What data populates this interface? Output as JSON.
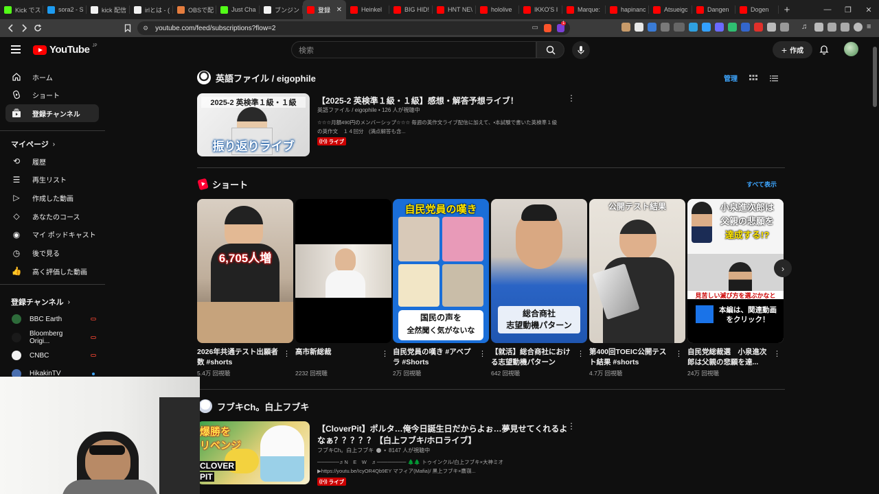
{
  "browser": {
    "tabs": [
      {
        "label": "Kick でス",
        "color": "#53fc18"
      },
      {
        "label": "sora2 - S",
        "color": "#1d9bf0"
      },
      {
        "label": "kick 配信",
        "color": "#f1f1f1"
      },
      {
        "label": "irlとは - (",
        "color": "#f1f1f1"
      },
      {
        "label": "OBSで配",
        "color": "#e57d3e"
      },
      {
        "label": "Just Cha",
        "color": "#53fc18"
      },
      {
        "label": "ブンジン",
        "color": "#f1f1f1"
      },
      {
        "label": "登録",
        "color": "#ff0000"
      },
      {
        "label": "Heinkel",
        "color": "#ff0000"
      },
      {
        "label": "BIG HID!",
        "color": "#ff0000"
      },
      {
        "label": "HNT NE\\",
        "color": "#ff0000"
      },
      {
        "label": "hololive",
        "color": "#ff0000"
      },
      {
        "label": "IKKO'S I",
        "color": "#ff0000"
      },
      {
        "label": "Marque:",
        "color": "#ff0000"
      },
      {
        "label": "hapinanc",
        "color": "#ff0000"
      },
      {
        "label": "Atsueigc",
        "color": "#ff0000"
      },
      {
        "label": "Dangen",
        "color": "#ff0000"
      },
      {
        "label": "Dogen",
        "color": "#ff0000"
      }
    ],
    "active_tab_index": 7,
    "url": "youtube.com/feed/subscriptions?flow=2",
    "shield_count": "1"
  },
  "masthead": {
    "logo_text": "YouTube",
    "region": "JP",
    "search_placeholder": "検索",
    "create_label": "作成"
  },
  "sidebar": {
    "primary": [
      {
        "label": "ホーム",
        "icon": "home-icon"
      },
      {
        "label": "ショート",
        "icon": "shorts-icon"
      },
      {
        "label": "登録チャンネル",
        "icon": "subscriptions-icon",
        "active": true
      }
    ],
    "you_heading": "マイページ",
    "you_items": [
      {
        "label": "履歴",
        "icon": "history-icon"
      },
      {
        "label": "再生リスト",
        "icon": "playlist-icon"
      },
      {
        "label": "作成した動画",
        "icon": "your-videos-icon"
      },
      {
        "label": "あなたのコース",
        "icon": "courses-icon"
      },
      {
        "label": "マイ ポッドキャスト",
        "icon": "podcast-icon"
      },
      {
        "label": "後で見る",
        "icon": "watch-later-icon"
      },
      {
        "label": "高く評価した動画",
        "icon": "liked-icon"
      }
    ],
    "subs_heading": "登録チャンネル",
    "subs": [
      {
        "label": "BBC Earth",
        "color": "#2d6b3a",
        "live": true
      },
      {
        "label": "Bloomberg Origi...",
        "color": "#1a1a1a",
        "live": true
      },
      {
        "label": "CNBC",
        "color": "#f1f1f1",
        "live": true
      },
      {
        "label": "HikakinTV",
        "color": "#4a6fb0",
        "live": false
      }
    ]
  },
  "view": {
    "manage_label": "管理"
  },
  "sections": {
    "channel1": {
      "name": "英語ファイル / eigophile",
      "video": {
        "title": "【2025-2 英検準１級・１級】感想・解答予想ライブ！",
        "meta": "英語ファイル / eigophile • 126 人が視聴中",
        "desc_line1": "☆☆☆月額490円のメンバーシップ☆☆☆ 毎週の英作文ライブ配信に加えて、•本試験で書いた英検準１級",
        "desc_line2": "の英作文　１４回分　(満点解答も含...",
        "badge": "ライブ",
        "thumb_caption_top": "2025-2 英検準１級・１級",
        "thumb_caption_bottom": "振り返りライブ"
      }
    },
    "shorts": {
      "heading": "ショート",
      "see_all": "すべて表示",
      "items": [
        {
          "title": "2026年共通テスト出願者数 #shorts",
          "views": "5.4万 回視聴",
          "overlay": "6,705人増"
        },
        {
          "title": "高市新総裁",
          "views": "2232 回視聴",
          "overlay": ""
        },
        {
          "title": "自民党員の嘆き #アベプラ #Shorts",
          "views": "2万 回視聴",
          "overlay_top": "自民党員の嘆き",
          "overlay_bottom1": "国民の声を",
          "overlay_bottom2": "全然聞く気がないな"
        },
        {
          "title": "【就活】総合商社における志望動機パターン",
          "views": "642 回視聴",
          "overlay_1": "総合商社",
          "overlay_2": "志望動機パターン"
        },
        {
          "title": "第400回TOEIC公開テスト結果 #shorts",
          "views": "4.7万 回視聴",
          "overlay_top": "公開テスト結果"
        },
        {
          "title": "自民党総裁選　小泉進次郎は父親の悲願を達...",
          "views": "24万 回視聴",
          "overlay_1": "小泉進次郎は",
          "overlay_2": "父親の悲願を",
          "overlay_3": "達成する!?",
          "overlay_4": "見苦しい滅び方を選ぶかなと",
          "overlay_5": "本編は、関連動画",
          "overlay_6": "をクリック！"
        }
      ]
    },
    "channel2": {
      "name": "フブキCh。白上フブキ",
      "video": {
        "title_line1": "【CloverPit】ポルタ…俺今日誕生日だからよぉ…夢見せてくれるよ",
        "title_line2": "なぁ？？？？？【白上フブキ/ホロライブ】",
        "channel": "フブキCh。白上フブキ",
        "viewers": "8147 人が視聴中",
        "desc_line1": "──────♬N　E　W　♬──────── 🌲🌲 トゥインクル/白上フブキ×大神ミオ",
        "desc_line2": "▶https://youtu.be/IcyOR4Qb9EY マフィア(Mafia)/ 黒上フブキ×鷹嶺...",
        "badge": "ライブ",
        "thumb_top": "爆勝を",
        "thumb_mid": "リベンジ",
        "thumb_bottom1": "CLOVER",
        "thumb_bottom2": "PIT"
      }
    }
  }
}
